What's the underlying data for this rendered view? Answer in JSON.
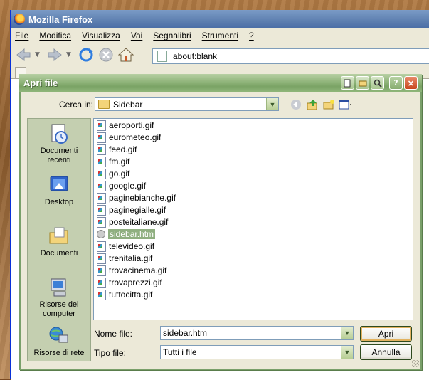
{
  "firefox": {
    "title": "Mozilla Firefox",
    "menu": [
      "File",
      "Modifica",
      "Visualizza",
      "Vai",
      "Segnalibri",
      "Strumenti",
      "?"
    ],
    "url": "about:blank"
  },
  "dialog": {
    "title": "Apri file",
    "look_in_label": "Cerca in:",
    "look_in_value": "Sidebar",
    "places": [
      {
        "label": "Documenti recenti",
        "icon": "recent-documents-icon"
      },
      {
        "label": "Desktop",
        "icon": "desktop-icon"
      },
      {
        "label": "Documenti",
        "icon": "documents-folder-icon"
      },
      {
        "label": "Risorse del computer",
        "icon": "my-computer-icon"
      },
      {
        "label": "Risorse di rete",
        "icon": "network-icon"
      }
    ],
    "files": [
      "aeroporti.gif",
      "eurometeo.gif",
      "feed.gif",
      "fm.gif",
      "go.gif",
      "google.gif",
      "paginebianche.gif",
      "paginegialle.gif",
      "posteitaliane.gif",
      "sidebar.htm",
      "televideo.gif",
      "trenitalia.gif",
      "trovacinema.gif",
      "trovaprezzi.gif",
      "tuttocitta.gif"
    ],
    "selected_file": "sidebar.htm",
    "filename_label": "Nome file:",
    "filename_value": "sidebar.htm",
    "filetype_label": "Tipo file:",
    "filetype_value": "Tutti i file",
    "open_button": "Apri",
    "cancel_button": "Annulla",
    "title_buttons": [
      "?",
      "×"
    ]
  },
  "colors": {
    "dialog_title": "#8fb47a",
    "selection": "#8faf80",
    "places_bar": "#c4cfb0"
  }
}
